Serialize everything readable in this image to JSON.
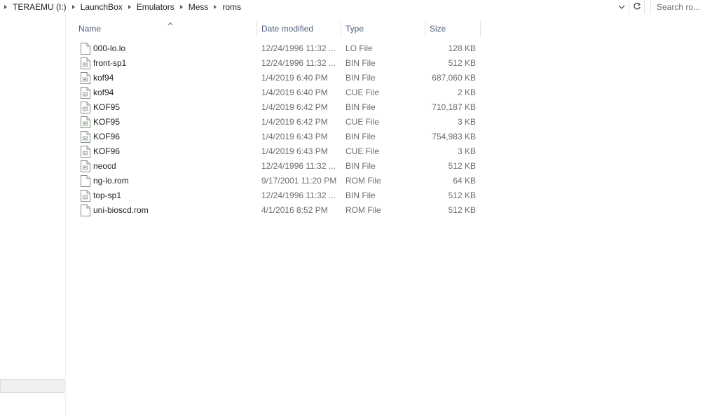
{
  "breadcrumb": {
    "items": [
      "TERAEMU (I:)",
      "LaunchBox",
      "Emulators",
      "Mess",
      "roms"
    ]
  },
  "search": {
    "placeholder": "Search ro..."
  },
  "columns": {
    "name": "Name",
    "date": "Date modified",
    "type": "Type",
    "size": "Size"
  },
  "files": [
    {
      "name": "000-lo.lo",
      "date": "12/24/1996 11:32 ...",
      "type": "LO File",
      "size": "128 KB",
      "icon": "blank-file-icon"
    },
    {
      "name": "front-sp1",
      "date": "12/24/1996 11:32 ...",
      "type": "BIN File",
      "size": "512 KB",
      "icon": "data-file-icon"
    },
    {
      "name": "kof94",
      "date": "1/4/2019 6:40 PM",
      "type": "BIN File",
      "size": "687,060 KB",
      "icon": "data-file-icon"
    },
    {
      "name": "kof94",
      "date": "1/4/2019 6:40 PM",
      "type": "CUE File",
      "size": "2 KB",
      "icon": "data-file-icon"
    },
    {
      "name": "KOF95",
      "date": "1/4/2019 6:42 PM",
      "type": "BIN File",
      "size": "710,187 KB",
      "icon": "data-file-icon"
    },
    {
      "name": "KOF95",
      "date": "1/4/2019 6:42 PM",
      "type": "CUE File",
      "size": "3 KB",
      "icon": "data-file-icon"
    },
    {
      "name": "KOF96",
      "date": "1/4/2019 6:43 PM",
      "type": "BIN File",
      "size": "754,983 KB",
      "icon": "data-file-icon"
    },
    {
      "name": "KOF96",
      "date": "1/4/2019 6:43 PM",
      "type": "CUE File",
      "size": "3 KB",
      "icon": "data-file-icon"
    },
    {
      "name": "neocd",
      "date": "12/24/1996 11:32 ...",
      "type": "BIN File",
      "size": "512 KB",
      "icon": "data-file-icon"
    },
    {
      "name": "ng-lo.rom",
      "date": "9/17/2001 11:20 PM",
      "type": "ROM File",
      "size": "64 KB",
      "icon": "blank-file-icon"
    },
    {
      "name": "top-sp1",
      "date": "12/24/1996 11:32 ...",
      "type": "BIN File",
      "size": "512 KB",
      "icon": "data-file-icon"
    },
    {
      "name": "uni-bioscd.rom",
      "date": "4/1/2016 8:52 PM",
      "type": "ROM File",
      "size": "512 KB",
      "icon": "blank-file-icon"
    }
  ],
  "colors": {
    "header_text": "#4c607a",
    "detail_text": "#6d6d6d",
    "text": "#1e1e1e"
  }
}
